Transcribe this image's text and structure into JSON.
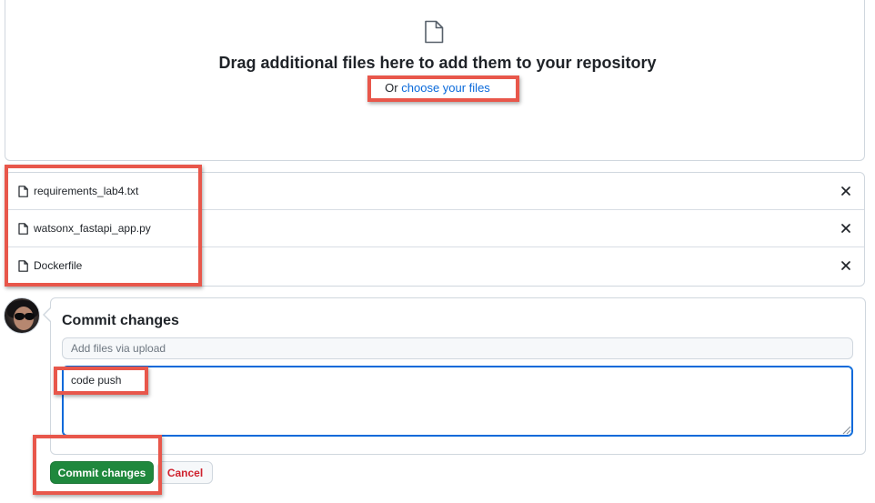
{
  "dropzone": {
    "title": "Drag additional files here to add them to your repository",
    "or_text": "Or",
    "choose_link": "choose your files"
  },
  "files": [
    {
      "name": "requirements_lab4.txt",
      "icon": "file-icon",
      "remove_icon": "close-icon"
    },
    {
      "name": "watsonx_fastapi_app.py",
      "icon": "file-icon",
      "remove_icon": "close-icon"
    },
    {
      "name": "Dockerfile",
      "icon": "file-icon",
      "remove_icon": "close-icon"
    }
  ],
  "commit": {
    "title": "Commit changes",
    "summary_placeholder": "Add files via upload",
    "summary_value": "",
    "description_value": "code push",
    "commit_button": "Commit changes",
    "cancel_button": "Cancel"
  },
  "colors": {
    "primary_green": "#1f883d",
    "link_blue": "#0969da",
    "danger_red": "#cf222e",
    "annotation_red": "#e8574b"
  }
}
